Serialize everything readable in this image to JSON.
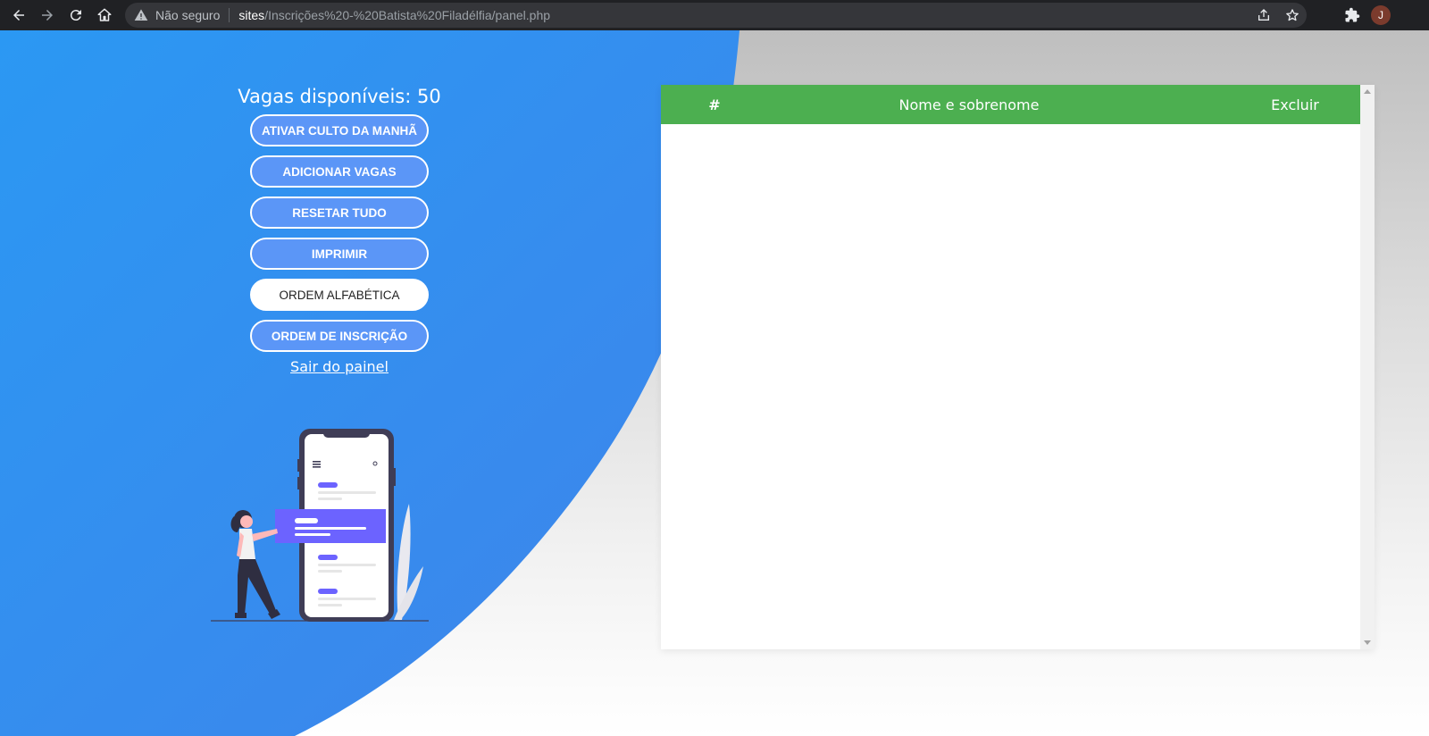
{
  "browser": {
    "security_label": "Não seguro",
    "url_host": "sites",
    "url_path": "/Inscrições%20-%20Batista%20Filadélfia/panel.php",
    "profile_initial": "J"
  },
  "panel": {
    "vagas_title": "Vagas disponíveis: 50",
    "buttons": [
      {
        "label": "ATIVAR CULTO DA MANHÃ"
      },
      {
        "label": "ADICIONAR VAGAS"
      },
      {
        "label": "RESETAR TUDO"
      },
      {
        "label": "IMPRIMIR"
      },
      {
        "label": "ORDEM ALFABÉTICA"
      },
      {
        "label": "ORDEM DE INSCRIÇÃO"
      }
    ],
    "logout_label": "Sair do painel"
  },
  "table": {
    "headers": [
      "#",
      "Nome e sobrenome",
      "Excluir"
    ],
    "rows": [],
    "header_color": "#4caf50"
  },
  "colors": {
    "accent_blue": "#2f8ff0",
    "button_blue": "#5b96f7",
    "illustration_purple": "#6c63ff"
  },
  "icons": [
    "back-icon",
    "forward-icon",
    "reload-icon",
    "home-icon",
    "warning-icon",
    "share-icon",
    "star-icon",
    "extensions-icon"
  ]
}
